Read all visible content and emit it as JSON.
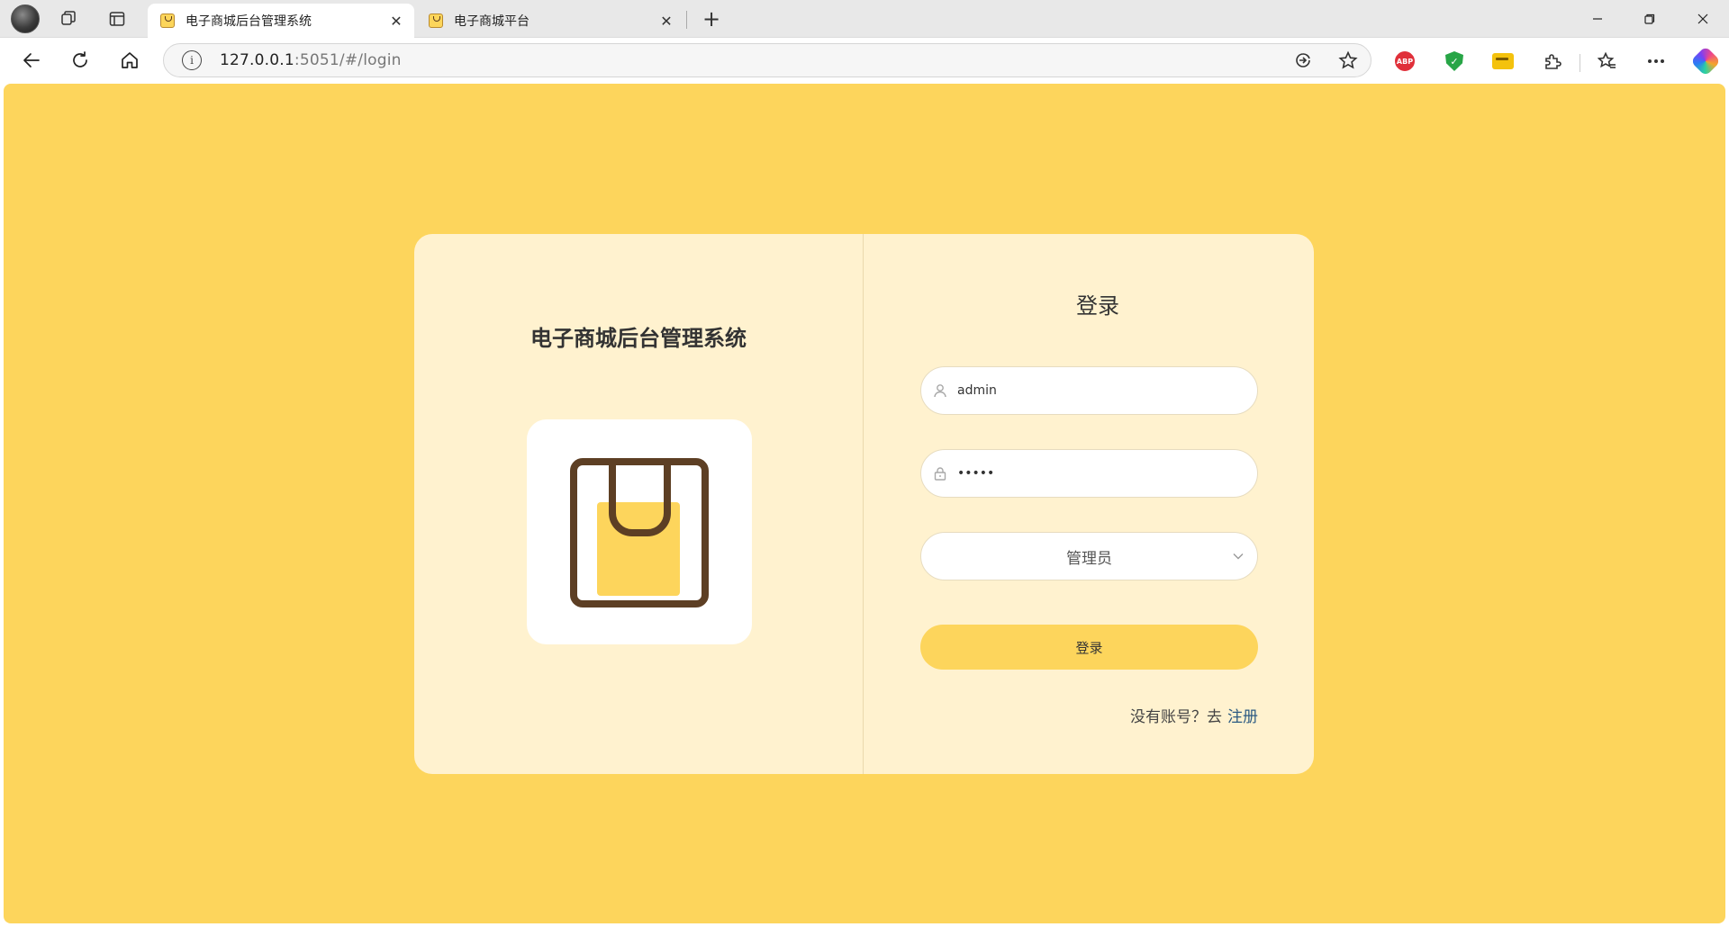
{
  "browser": {
    "tabs": [
      {
        "title": "电子商城后台管理系统",
        "active": true
      },
      {
        "title": "电子商城平台",
        "active": false
      }
    ],
    "url_host": "127.0.0.1",
    "url_rest": ":5051/#/login",
    "icons": {
      "profile": "profile-avatar",
      "workspaces": "workspaces-icon",
      "tab_actions": "tab-actions-icon",
      "back": "back-arrow-icon",
      "refresh": "refresh-icon",
      "home": "home-icon",
      "site_info": "info-icon",
      "read_aloud": "immersive-reader-icon",
      "favorite": "star-icon",
      "extensions": [
        "adblock-plus-icon",
        "shield-extension-icon",
        "tag-extension-icon",
        "puzzle-icon",
        "favorites-icon",
        "more-icon",
        "copilot-icon"
      ]
    }
  },
  "page": {
    "background_color": "#fdd55c",
    "card_color": "#fff2cf",
    "system_title": "电子商城后台管理系统",
    "login": {
      "heading": "登录",
      "username_value": "admin",
      "password_value": "•••••",
      "role_selected": "管理员",
      "submit_label": "登录",
      "register_prompt": "没有账号？去",
      "register_link": "注册"
    }
  }
}
